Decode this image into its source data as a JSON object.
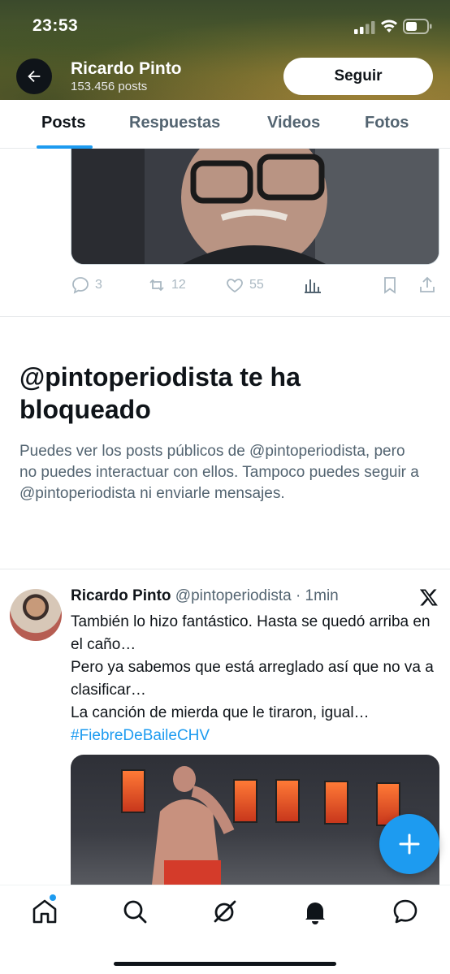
{
  "status_bar": {
    "time": "23:53"
  },
  "profile": {
    "name": "Ricardo Pinto",
    "posts_count": "153.456 posts",
    "follow_label": "Seguir"
  },
  "tabs": [
    {
      "label": "Posts",
      "active": true
    },
    {
      "label": "Respuestas",
      "active": false
    },
    {
      "label": "Videos",
      "active": false
    },
    {
      "label": "Fotos",
      "active": false
    }
  ],
  "tweet1_actions": {
    "replies": "3",
    "retweets": "12",
    "likes": "55"
  },
  "blocked": {
    "title": "@pintoperiodista te ha bloqueado",
    "text": "Puedes ver los posts públicos de @pintoperiodista, pero no puedes interactuar con ellos. Tampoco puedes seguir a @pintoperiodista ni enviarle mensajes."
  },
  "tweet2": {
    "name": "Ricardo Pinto",
    "handle": "@pintoperiodista",
    "time": "· 1min",
    "line1": "También lo hizo fantástico. Hasta se quedó arriba en el caño…",
    "line2": "Pero ya sabemos que está arreglado así que no va a clasificar…",
    "line3": "La canción de mierda que le tiraron, igual…",
    "hashtag": "#FiebreDeBaileCHV"
  },
  "colors": {
    "accent": "#1d9bf0",
    "text": "#0f1419",
    "secondary": "#536471"
  },
  "icons": {
    "nav": [
      "home-icon",
      "search-icon",
      "grok-icon",
      "notifications-icon",
      "messages-icon"
    ],
    "fab": "compose-icon"
  }
}
